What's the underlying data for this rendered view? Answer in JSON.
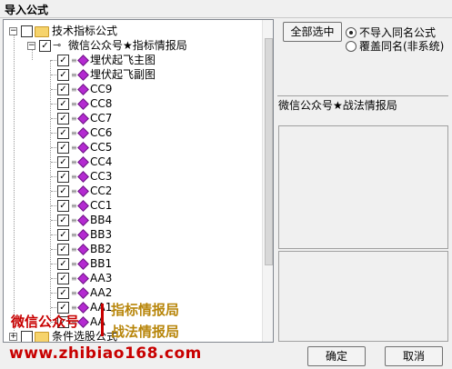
{
  "window": {
    "title": "导入公式"
  },
  "tree": {
    "root": {
      "label": "技术指标公式",
      "expander": "−"
    },
    "group": {
      "label": "微信公众号★指标情报局",
      "expander": "−"
    },
    "items": [
      {
        "label": "埋伏起飞主图"
      },
      {
        "label": "埋伏起飞副图"
      },
      {
        "label": "CC9"
      },
      {
        "label": "CC8"
      },
      {
        "label": "CC7"
      },
      {
        "label": "CC6"
      },
      {
        "label": "CC5"
      },
      {
        "label": "CC4"
      },
      {
        "label": "CC3"
      },
      {
        "label": "CC2"
      },
      {
        "label": "CC1"
      },
      {
        "label": "BB4"
      },
      {
        "label": "BB3"
      },
      {
        "label": "BB2"
      },
      {
        "label": "BB1"
      },
      {
        "label": "AA3"
      },
      {
        "label": "AA2"
      },
      {
        "label": "AA1"
      },
      {
        "label": "AA"
      }
    ],
    "root2": {
      "label": "条件选股公式",
      "expander": "+"
    },
    "check_mark": "✓"
  },
  "buttons": {
    "select_all": "全部选中",
    "ok": "确定",
    "cancel": "取消"
  },
  "options": {
    "no_import": {
      "label": "不导入同名公式",
      "selected": true
    },
    "overwrite": {
      "label": "覆盖同名(非系统)",
      "selected": false
    }
  },
  "info": {
    "source": "微信公众号★战法情报局"
  },
  "watermark": {
    "left": "微信公众号",
    "right_top": "指标情报局",
    "right_bottom": "战法情报局",
    "url": "www.zhibiao168.com"
  }
}
